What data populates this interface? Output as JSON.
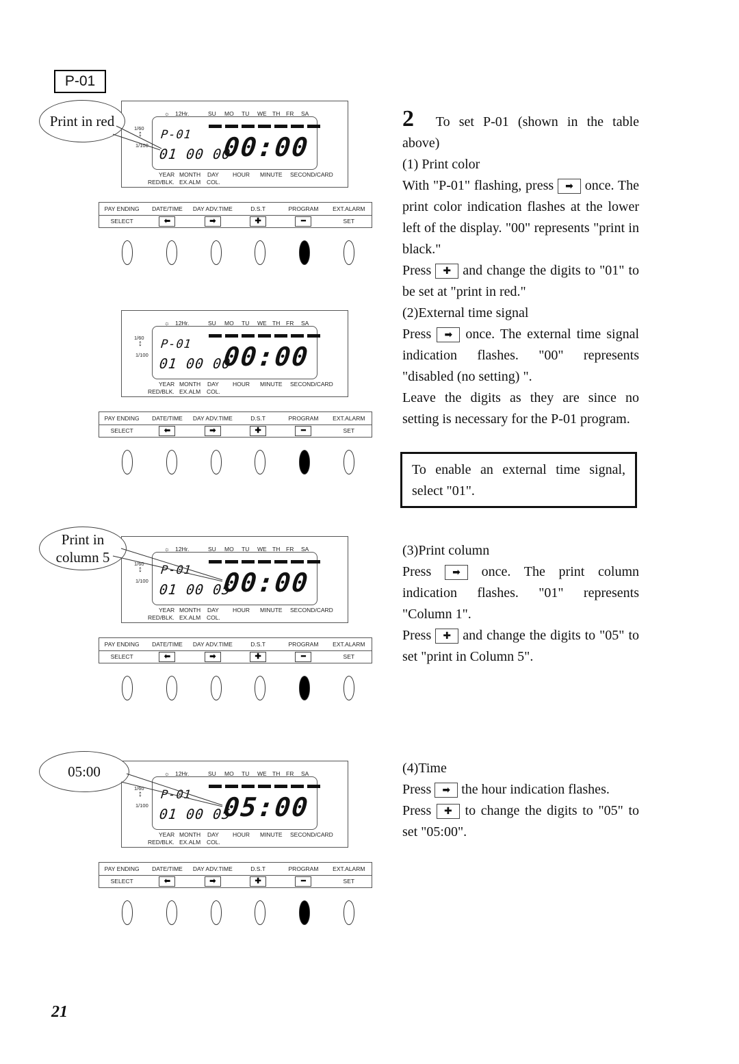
{
  "program_tag": "P-01",
  "page_number": "21",
  "panel_labels": {
    "clock_icon": "☼",
    "mode": "12Hr.",
    "days": [
      "SU",
      "MO",
      "TU",
      "WE",
      "TH",
      "FR",
      "SA"
    ],
    "resolution_top": "1/60",
    "resolution_bottom": "1/100",
    "fields_row1": [
      "YEAR",
      "MONTH",
      "DAY",
      "HOUR",
      "MINUTE",
      "SECOND/CARD"
    ],
    "fields_row2": [
      "RED/BLK.",
      "EX.ALM",
      "COL."
    ]
  },
  "button_strip": {
    "functions": [
      "PAY ENDING",
      "DATE/TIME",
      "DAY ADV.TIME",
      "D.S.T",
      "PROGRAM",
      "EXT.ALARM"
    ],
    "controls": [
      "SELECT",
      "←",
      "→",
      "+",
      "−",
      "SET"
    ],
    "active_index": 4
  },
  "steps": [
    {
      "callout": "Print in red",
      "program": "P-01",
      "small_digits": "01 00 00",
      "time": "00:00",
      "flashing": "RED/BLK."
    },
    {
      "callout": "",
      "program": "P-01",
      "small_digits": "01 00 00",
      "time": "00:00",
      "flashing": "EX.ALM"
    },
    {
      "callout": "Print in column 5",
      "callout_line1": "Print in",
      "callout_line2": "column 5",
      "program": "P-01",
      "small_digits": "01 00 05",
      "time": "00:00",
      "flashing": "COL."
    },
    {
      "callout": "05:00",
      "program": "P-01",
      "small_digits": "01 00 05",
      "time": "05:00",
      "flashing": "HOUR"
    }
  ],
  "instructions": {
    "step_number": "2",
    "heading": "To set P-01 (shown in the table above)",
    "sections": [
      {
        "title": "(1) Print color",
        "p1a": "With \"P-01\" flashing, press",
        "p1b": "once. The print color indication flashes at the lower left of the display. \"00\" represents \"print in black.\"",
        "p2a": "Press",
        "p2b": "and change the digits to \"01\" to be set at \"print in red.\""
      },
      {
        "title": "(2)External time signal",
        "p1a": "Press",
        "p1b": "once. The external time signal indication flashes. \"00\" represents \"disabled (no setting) \".",
        "p2": "Leave the digits as they are since no setting is necessary for the P-01 program."
      },
      {
        "title": "(3)Print column",
        "p1a": "Press",
        "p1b": "once. The print column indication flashes. \"01\" represents \"Column 1\".",
        "p2a": "Press",
        "p2b": "and change the digits to \"05\" to set \"print in Column 5\"."
      },
      {
        "title": "(4)Time",
        "p1a": "Press",
        "p1b": "the hour indication flashes.",
        "p2a": "Press",
        "p2b": "to change the digits to \"05\" to set \"05:00\"."
      }
    ],
    "note": "To enable an external time signal, select \"01\"."
  },
  "icons": {
    "right_arrow": "➡",
    "plus": "✚"
  }
}
